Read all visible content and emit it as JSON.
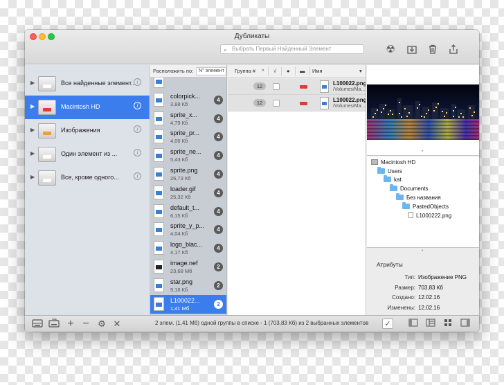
{
  "window": {
    "title": "Дубликаты",
    "search_placeholder": "Выбрать Первый Найденный Элемент",
    "toolbar_icons": [
      "radiation-icon",
      "download-icon",
      "trash-icon",
      "share-icon"
    ]
  },
  "sidebar": {
    "items": [
      {
        "label": "Все найденные элемент...",
        "drive_color": "#ffffff",
        "selected": false
      },
      {
        "label": "Macintosh HD",
        "drive_color": "#e23a3a",
        "selected": true
      },
      {
        "label": "Изображения",
        "drive_color": "#f0a030",
        "selected": false
      },
      {
        "label": "Один элемент из ...",
        "drive_color": "#ffffff",
        "selected": false
      },
      {
        "label": "Все, кроме одного...",
        "drive_color": "#ffffff",
        "selected": false
      }
    ]
  },
  "files": {
    "sort_label": "Расположить по:",
    "sort_value": "N° элемент",
    "items": [
      {
        "name": "",
        "size": "",
        "count": ""
      },
      {
        "name": "colorpick...",
        "size": "3,88 Кб",
        "count": "4"
      },
      {
        "name": "sprite_x...",
        "size": "4,79 Кб",
        "count": "4"
      },
      {
        "name": "sprite_pr...",
        "size": "4,06 Кб",
        "count": "4"
      },
      {
        "name": "sprite_ne...",
        "size": "5,43 Кб",
        "count": "4"
      },
      {
        "name": "sprite.png",
        "size": "26,73 Кб",
        "count": "4"
      },
      {
        "name": "loader.gif",
        "size": "25,32 Кб",
        "count": "4"
      },
      {
        "name": "default_t...",
        "size": "6,15 Кб",
        "count": "4"
      },
      {
        "name": "sprite_y_p...",
        "size": "4,04 Кб",
        "count": "4"
      },
      {
        "name": "logo_blac...",
        "size": "4,17 Кб",
        "count": "4"
      },
      {
        "name": "image.nef",
        "size": "23,68 Мб",
        "count": "2"
      },
      {
        "name": "star.png",
        "size": "9,16 Кб",
        "count": "2"
      },
      {
        "name": "L100022...",
        "size": "1,41 Мб",
        "count": "2"
      }
    ]
  },
  "groups": {
    "headers": {
      "group": "Группа #",
      "check": "√",
      "name": "Имя"
    },
    "rows": [
      {
        "group": "12",
        "name": "L100022.png",
        "path": "/Volumes/Ma..."
      },
      {
        "group": "12",
        "name": "L100022.png",
        "path": "/Volumes/Ma..."
      }
    ]
  },
  "tree": [
    {
      "label": "Macintosh HD",
      "kind": "drive"
    },
    {
      "label": "Users",
      "kind": "folder"
    },
    {
      "label": "kat",
      "kind": "folder"
    },
    {
      "label": "Documents",
      "kind": "folder"
    },
    {
      "label": "Без названия",
      "kind": "folder"
    },
    {
      "label": "PastedObjects",
      "kind": "folder"
    },
    {
      "label": "L1000222.png",
      "kind": "file"
    }
  ],
  "attributes": {
    "title": "Атрибуты",
    "rows": [
      {
        "key": "Тип:",
        "value": "Изображение PNG"
      },
      {
        "key": "Размер:",
        "value": "703,83 Кб"
      },
      {
        "key": "Создано:",
        "value": "12.02.16"
      },
      {
        "key": "Изменены:",
        "value": "12.02.16"
      }
    ]
  },
  "status": "2 элем. (1,41 Мб) одной группы в списке - 1 (703,83 Кб) из 2 выбранных элементов"
}
